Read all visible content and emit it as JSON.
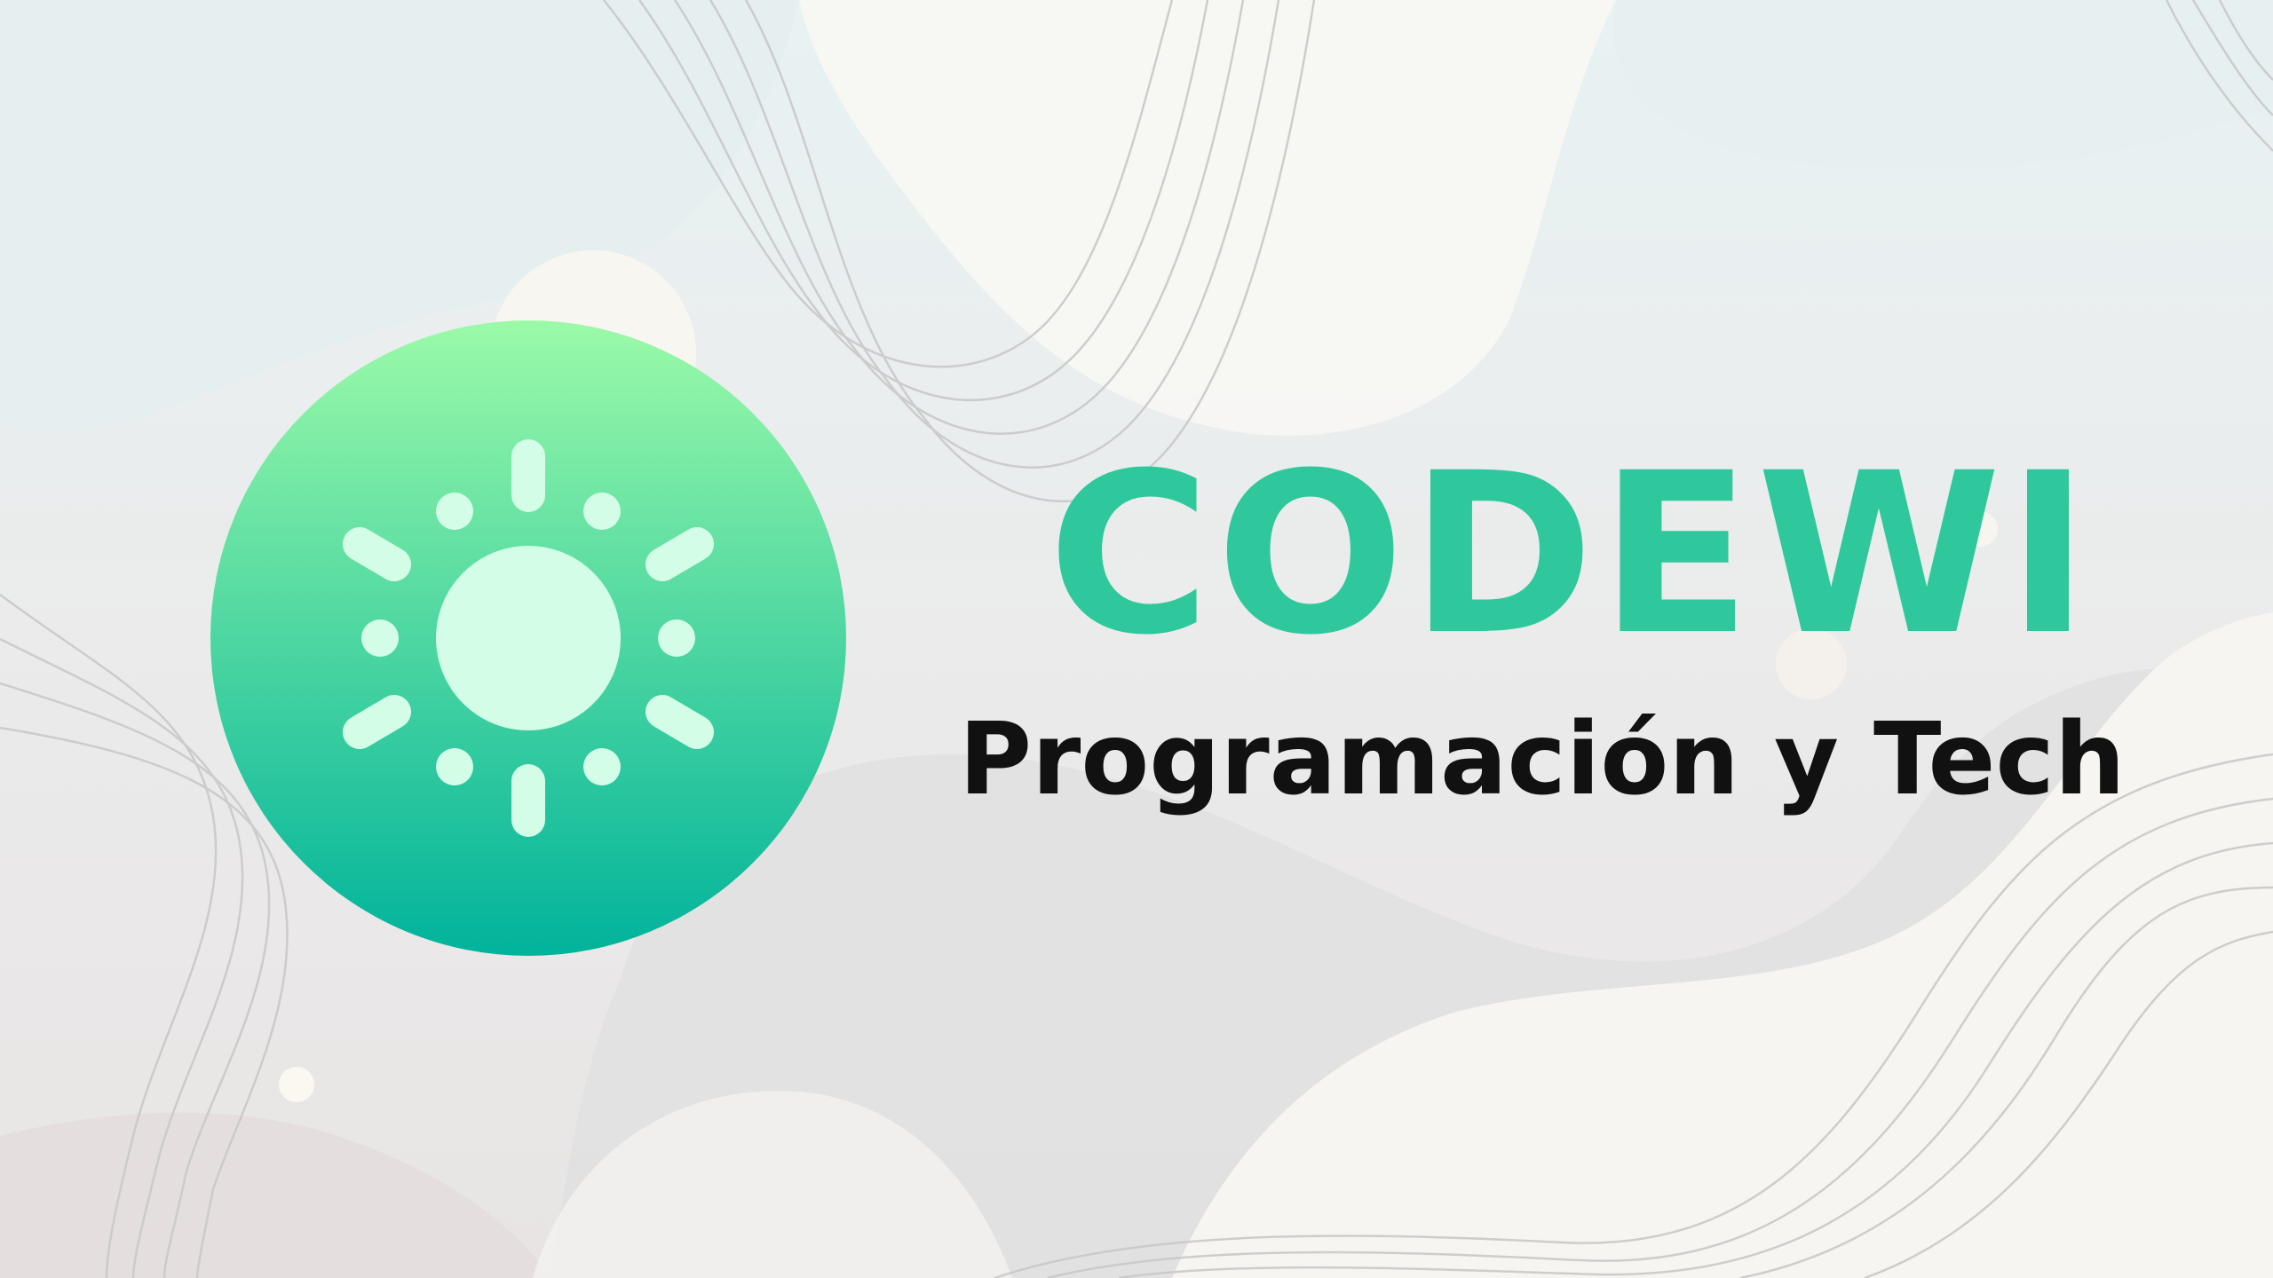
{
  "brand": {
    "name": "CODEWI",
    "tagline": "Programación y Tech"
  },
  "logo": {
    "icon": "sun-icon",
    "gradient_top": "#9bfaa8",
    "gradient_bottom": "#00b39b",
    "glyph_color": "#d4fde8"
  },
  "colors": {
    "title": "#2ec89c",
    "subtitle": "#111111",
    "background": "#eceeee"
  }
}
